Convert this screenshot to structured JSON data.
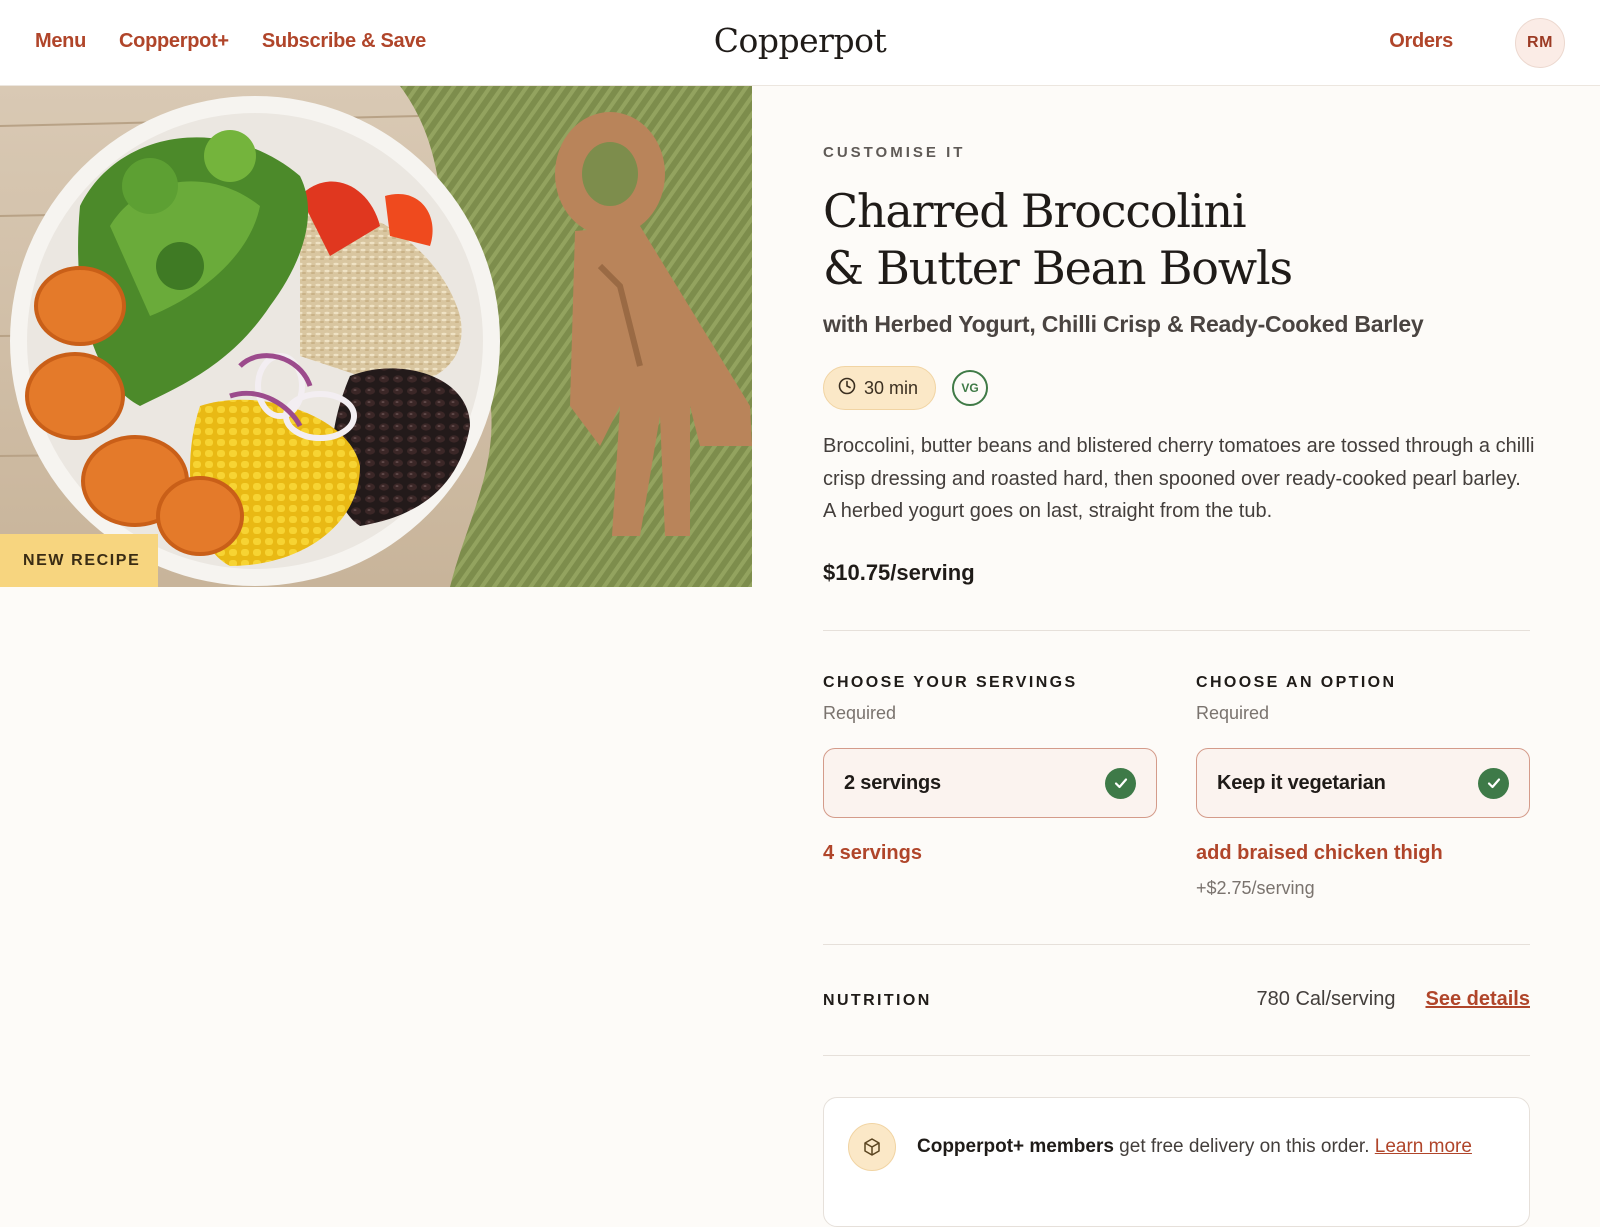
{
  "nav": {
    "links": [
      "Menu",
      "Copperpot+",
      "Subscribe & Save"
    ],
    "logo": "Copperpot",
    "orders": "Orders",
    "avatar_initials": "RM"
  },
  "hero": {
    "badge": "NEW RECIPE"
  },
  "recipe": {
    "eyebrow": "CUSTOMISE IT",
    "title_line1": "Charred Broccolini",
    "title_line2": "& Butter Bean Bowls",
    "subtitle": "with Herbed Yogurt, Chilli Crisp & Ready-Cooked Barley",
    "time": "30 min",
    "diet_badge": "VG",
    "description": "Broccolini, butter beans and blistered cherry tomatoes are tossed through a chilli crisp dressing and roasted hard, then spooned over ready-cooked pearl barley. A herbed yogurt goes on last, straight from the tub.",
    "price": "$10.75/serving"
  },
  "servings": {
    "title": "CHOOSE YOUR SERVINGS",
    "required": "Required",
    "selected": "2 servings",
    "alternative": "4 servings"
  },
  "option": {
    "title": "CHOOSE AN OPTION",
    "required": "Required",
    "selected": "Keep it vegetarian",
    "alternative": "add braised chicken thigh",
    "alternative_price": "+$2.75/serving"
  },
  "nutrition": {
    "label": "NUTRITION",
    "calories": "780 Cal/serving",
    "link": "See details"
  },
  "promo": {
    "strong": "Copperpot+ members",
    "text": " get free delivery on this order. ",
    "link": "Learn more"
  },
  "colors": {
    "accent": "#b0452a",
    "check_green": "#3e7a48",
    "badge_yellow": "#f7d57f",
    "background": "#fdfbf8"
  }
}
